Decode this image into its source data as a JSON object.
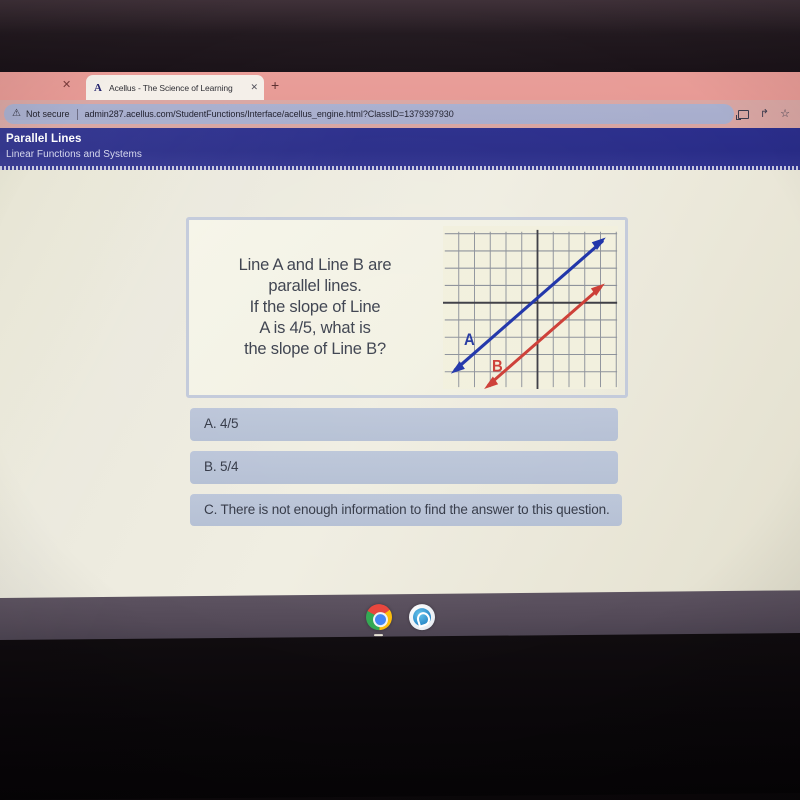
{
  "browser": {
    "tab": {
      "favicon_label": "A",
      "favicon_icon": "acellus-a-icon",
      "title": "Acellus - The Science of Learning",
      "close_label": "✕",
      "left_close_label": "✕"
    },
    "new_tab_label": "+",
    "omnibox": {
      "warning_icon": "warning-triangle-icon",
      "warning_glyph": "⚠",
      "security_label": "Not secure",
      "url": "admin287.acellus.com/StudentFunctions/Interface/acellus_engine.html?ClassID=1379397930"
    },
    "toolbar_icons": {
      "cast": "cast-icon",
      "share_glyph": "↱",
      "share_name": "share-icon",
      "bookmark_glyph": "☆",
      "bookmark_name": "star-bookmark-icon"
    }
  },
  "lesson": {
    "title": "Parallel Lines",
    "subtitle": "Linear Functions and Systems"
  },
  "question": {
    "text": "Line A and Line B are parallel lines. If the slope of Line A is 4/5, what is the slope of Line B?",
    "lines": [
      "Line A and Line B are",
      "parallel lines.",
      "If the slope of Line",
      "A is 4/5, what is",
      "the slope of Line B?"
    ]
  },
  "graph": {
    "line_a_label": "A",
    "line_b_label": "B",
    "line_a_color": "#1c31a8",
    "line_b_color": "#cc3b33",
    "axis_color": "#3a3a42",
    "grid_color": "#8b8fa8",
    "background": "#f2f0dd",
    "columns": 11,
    "rows": 9
  },
  "answers": [
    {
      "letter": "A.",
      "text": "4/5",
      "full": "A.  4/5"
    },
    {
      "letter": "B.",
      "text": "5/4",
      "full": "B.  5/4"
    },
    {
      "letter": "C.",
      "text": "There is not enough information to find the answer to this question.",
      "full": "C.  There is not enough information to find the answer to this question."
    }
  ],
  "shelf": {
    "items": [
      {
        "name": "chrome-icon",
        "label": "Google Chrome",
        "active": true
      },
      {
        "name": "browser-globe-icon",
        "label": "Browser",
        "active": false
      }
    ]
  },
  "colors": {
    "header_blue": "#2b2e8c",
    "tabstrip_pink": "#e99d98",
    "page_cream": "#efeee1",
    "answer_blue": "#bcc6d9"
  }
}
